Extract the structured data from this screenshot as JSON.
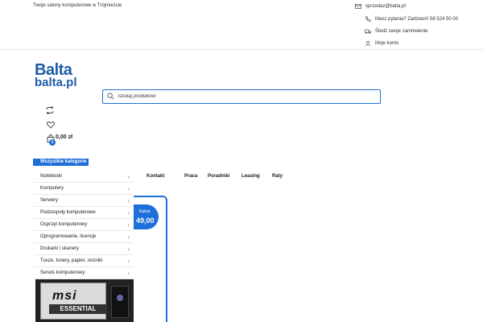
{
  "topbar": {
    "tagline": "Twoje salony komputerowe w Trójmieście",
    "email": "sprzedaz@balta.pl",
    "phone": "Masz pytania? Zadzwoń! 58 524 50 00",
    "track_order": "Śledź swoje zamówienie",
    "account": "Moje konto"
  },
  "logo": {
    "line1": "Balta",
    "line2": "balta.pl"
  },
  "search": {
    "placeholder": "Szukaj produktów"
  },
  "cart": {
    "count": "0",
    "total": "0,00 zł"
  },
  "categories": {
    "header": "Wszystkie kategorie",
    "items": [
      "Notebooki",
      "Komputery",
      "Serwery",
      "Podzespoły komputerowe",
      "Osprzęt komputerowy",
      "Oprogramowanie, licencje",
      "Drukarki i skanery",
      "Tusze, tonery, papier, nośniki",
      "Serwis komputerowy"
    ]
  },
  "nav": [
    "Kontakt",
    "Praca",
    "Poradniki",
    "Leasing",
    "Raty"
  ],
  "promo": {
    "label": "Rabat",
    "value": "49,00"
  },
  "product": {
    "brand": "msi",
    "name": "ESSENTIAL"
  },
  "colors": {
    "accent": "#1e6fd9",
    "logo": "#1f5da8"
  }
}
